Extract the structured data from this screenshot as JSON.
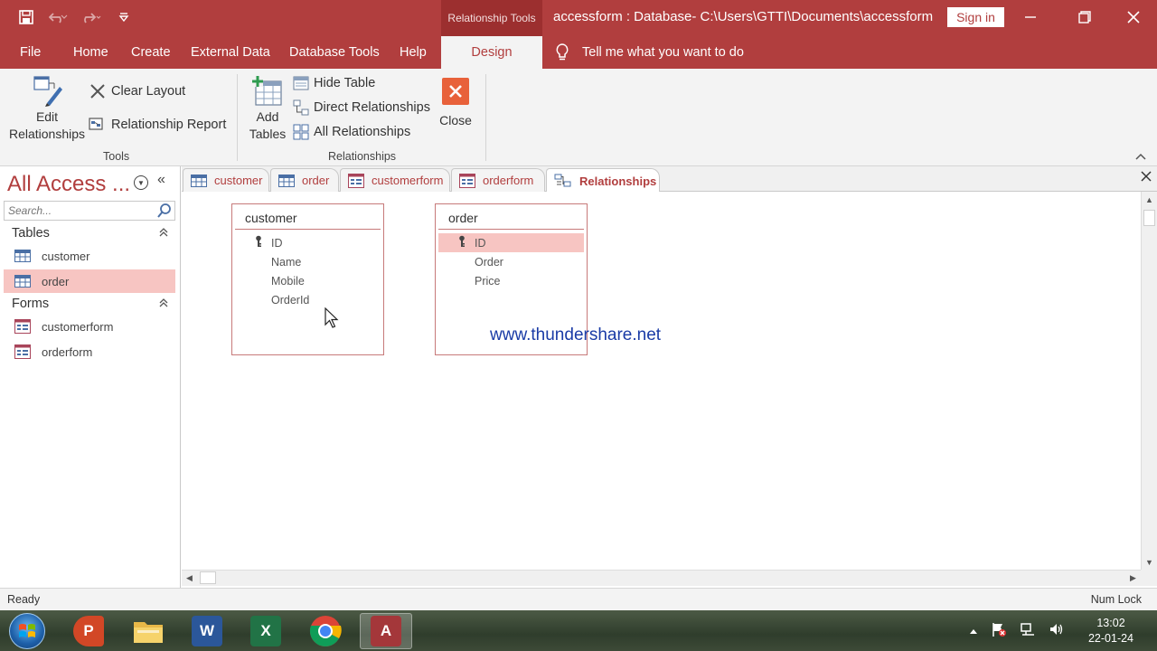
{
  "titlebar": {
    "context_tab": "Relationship Tools",
    "window_title": "accessform : Database- C:\\Users\\GTTI\\Documents\\accessform.acc...",
    "sign_in": "Sign in"
  },
  "ribbon_tabs": [
    "File",
    "Home",
    "Create",
    "External Data",
    "Database Tools",
    "Help",
    "Design"
  ],
  "tell_me": "Tell me what you want to do",
  "ribbon": {
    "edit_relationships": [
      "Edit",
      "Relationships"
    ],
    "clear_layout": "Clear Layout",
    "relationship_report": "Relationship Report",
    "tools_label": "Tools",
    "add_tables": [
      "Add",
      "Tables"
    ],
    "hide_table": "Hide Table",
    "direct_relationships": "Direct Relationships",
    "all_relationships": "All Relationships",
    "close": "Close",
    "relationships_label": "Relationships"
  },
  "nav": {
    "title": "All Access ...",
    "search_placeholder": "Search...",
    "sections": [
      {
        "label": "Tables",
        "items": [
          "customer",
          "order"
        ]
      },
      {
        "label": "Forms",
        "items": [
          "customerform",
          "orderform"
        ]
      }
    ],
    "selected_item": "order"
  },
  "doc_tabs": [
    "customer",
    "order",
    "customerform",
    "orderform",
    "Relationships"
  ],
  "active_doc_tab": "Relationships",
  "tables": [
    {
      "name": "customer",
      "fields": [
        "ID",
        "Name",
        "Mobile",
        "OrderId"
      ]
    },
    {
      "name": "order",
      "fields": [
        "ID",
        "Order",
        "Price"
      ]
    }
  ],
  "watermark": "www.thundershare.net",
  "status": {
    "left": "Ready",
    "right": "Num Lock"
  },
  "clock": {
    "time": "13:02",
    "date": "22-01-24"
  },
  "colors": {
    "accent": "#b13e3e",
    "selection": "#f7c5c2",
    "watermark": "#1a3ba6"
  }
}
